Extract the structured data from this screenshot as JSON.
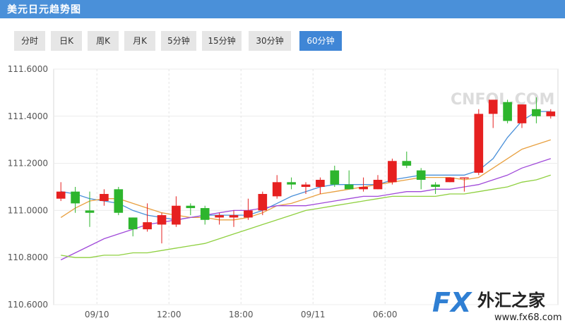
{
  "header": {
    "title": "美元日元趋势图",
    "bg_color": "#4a90d9"
  },
  "tabs": [
    {
      "label": "分时",
      "active": false
    },
    {
      "label": "日K",
      "active": false
    },
    {
      "label": "周K",
      "active": false
    },
    {
      "label": "月K",
      "active": false
    },
    {
      "label": "5分钟",
      "active": false
    },
    {
      "label": "15分钟",
      "active": false
    },
    {
      "label": "30分钟",
      "active": false
    },
    {
      "label": "60分钟",
      "active": true
    }
  ],
  "watermark": {
    "text": "CNFOL.COM",
    "logo_fx": "FX",
    "logo_cn": "外汇之家",
    "logo_url": "www.fx68.com"
  },
  "chart_data": {
    "type": "candlestick",
    "y_ticks": [
      "111.6000",
      "111.4000",
      "111.2000",
      "111.0000",
      "110.8000",
      "110.6000"
    ],
    "ylim": [
      110.6,
      111.6
    ],
    "x_ticks": [
      {
        "label": "09/10",
        "index": 2.5
      },
      {
        "label": "12:00",
        "index": 7.5
      },
      {
        "label": "18:00",
        "index": 12.5
      },
      {
        "label": "09/11",
        "index": 17.5
      },
      {
        "label": "06:00",
        "index": 22.5
      }
    ],
    "up_color": "#e62020",
    "down_color": "#2db52d",
    "candles": [
      {
        "o": 111.05,
        "h": 111.12,
        "l": 111.04,
        "c": 111.08
      },
      {
        "o": 111.08,
        "h": 111.1,
        "l": 110.99,
        "c": 111.03
      },
      {
        "o": 111.0,
        "h": 111.08,
        "l": 110.93,
        "c": 110.99
      },
      {
        "o": 111.04,
        "h": 111.09,
        "l": 111.02,
        "c": 111.07
      },
      {
        "o": 111.09,
        "h": 111.1,
        "l": 110.98,
        "c": 110.99
      },
      {
        "o": 110.97,
        "h": 110.97,
        "l": 110.89,
        "c": 110.92
      },
      {
        "o": 110.92,
        "h": 111.03,
        "l": 110.91,
        "c": 110.95
      },
      {
        "o": 110.94,
        "h": 110.99,
        "l": 110.86,
        "c": 110.98
      },
      {
        "o": 110.94,
        "h": 111.06,
        "l": 110.93,
        "c": 111.02
      },
      {
        "o": 111.02,
        "h": 111.03,
        "l": 110.98,
        "c": 111.01
      },
      {
        "o": 111.01,
        "h": 111.02,
        "l": 110.94,
        "c": 110.96
      },
      {
        "o": 110.97,
        "h": 110.99,
        "l": 110.94,
        "c": 110.98
      },
      {
        "o": 110.97,
        "h": 111.0,
        "l": 110.93,
        "c": 110.98
      },
      {
        "o": 110.97,
        "h": 111.05,
        "l": 110.96,
        "c": 111.0
      },
      {
        "o": 111.0,
        "h": 111.08,
        "l": 110.98,
        "c": 111.07
      },
      {
        "o": 111.06,
        "h": 111.15,
        "l": 111.05,
        "c": 111.12
      },
      {
        "o": 111.12,
        "h": 111.14,
        "l": 111.09,
        "c": 111.11
      },
      {
        "o": 111.1,
        "h": 111.12,
        "l": 111.07,
        "c": 111.11
      },
      {
        "o": 111.1,
        "h": 111.14,
        "l": 111.07,
        "c": 111.13
      },
      {
        "o": 111.17,
        "h": 111.19,
        "l": 111.1,
        "c": 111.11
      },
      {
        "o": 111.11,
        "h": 111.17,
        "l": 111.09,
        "c": 111.09
      },
      {
        "o": 111.09,
        "h": 111.14,
        "l": 111.08,
        "c": 111.1
      },
      {
        "o": 111.09,
        "h": 111.15,
        "l": 111.09,
        "c": 111.13
      },
      {
        "o": 111.12,
        "h": 111.22,
        "l": 111.11,
        "c": 111.21
      },
      {
        "o": 111.21,
        "h": 111.25,
        "l": 111.18,
        "c": 111.19
      },
      {
        "o": 111.17,
        "h": 111.18,
        "l": 111.09,
        "c": 111.13
      },
      {
        "o": 111.11,
        "h": 111.12,
        "l": 111.07,
        "c": 111.1
      },
      {
        "o": 111.12,
        "h": 111.14,
        "l": 111.12,
        "c": 111.14
      },
      {
        "o": 111.14,
        "h": 111.14,
        "l": 111.08,
        "c": 111.14
      },
      {
        "o": 111.16,
        "h": 111.43,
        "l": 111.15,
        "c": 111.41
      },
      {
        "o": 111.41,
        "h": 111.47,
        "l": 111.35,
        "c": 111.47
      },
      {
        "o": 111.46,
        "h": 111.47,
        "l": 111.37,
        "c": 111.38
      },
      {
        "o": 111.37,
        "h": 111.45,
        "l": 111.35,
        "c": 111.45
      },
      {
        "o": 111.43,
        "h": 111.48,
        "l": 111.37,
        "c": 111.4
      },
      {
        "o": 111.4,
        "h": 111.43,
        "l": 111.39,
        "c": 111.42
      }
    ],
    "ma_lines": [
      {
        "color": "#4a90d9",
        "start": 0,
        "values": [
          111.08,
          111.07,
          111.05,
          111.04,
          111.03,
          111.0,
          110.98,
          110.97,
          110.96,
          110.97,
          110.98,
          110.98,
          110.98,
          110.98,
          111.0,
          111.03,
          111.06,
          111.08,
          111.1,
          111.11,
          111.11,
          111.11,
          111.11,
          111.13,
          111.14,
          111.15,
          111.15,
          111.15,
          111.15,
          111.17,
          111.22,
          111.31,
          111.38,
          111.42,
          111.42
        ]
      },
      {
        "color": "#e8a040",
        "start": 0,
        "values": [
          110.97,
          111.01,
          111.04,
          111.05,
          111.05,
          111.03,
          111.01,
          110.99,
          110.98,
          110.97,
          110.97,
          110.96,
          110.96,
          110.97,
          110.99,
          111.02,
          111.03,
          111.05,
          111.07,
          111.08,
          111.09,
          111.1,
          111.11,
          111.12,
          111.13,
          111.14,
          111.14,
          111.14,
          111.13,
          111.14,
          111.18,
          111.22,
          111.26,
          111.28,
          111.3
        ]
      },
      {
        "color": "#a04ad9",
        "start": 0,
        "values": [
          110.79,
          110.82,
          110.85,
          110.88,
          110.9,
          110.92,
          110.94,
          110.95,
          110.96,
          110.97,
          110.98,
          110.99,
          111.0,
          111.0,
          111.01,
          111.02,
          111.02,
          111.02,
          111.03,
          111.04,
          111.05,
          111.06,
          111.06,
          111.07,
          111.08,
          111.08,
          111.09,
          111.09,
          111.1,
          111.11,
          111.13,
          111.15,
          111.18,
          111.2,
          111.22
        ]
      },
      {
        "color": "#8fd040",
        "start": 0,
        "values": [
          110.81,
          110.8,
          110.8,
          110.81,
          110.81,
          110.82,
          110.82,
          110.83,
          110.84,
          110.85,
          110.86,
          110.88,
          110.9,
          110.92,
          110.94,
          110.96,
          110.98,
          111.0,
          111.01,
          111.02,
          111.03,
          111.04,
          111.05,
          111.06,
          111.06,
          111.06,
          111.06,
          111.07,
          111.07,
          111.08,
          111.09,
          111.1,
          111.12,
          111.13,
          111.15
        ]
      }
    ]
  }
}
